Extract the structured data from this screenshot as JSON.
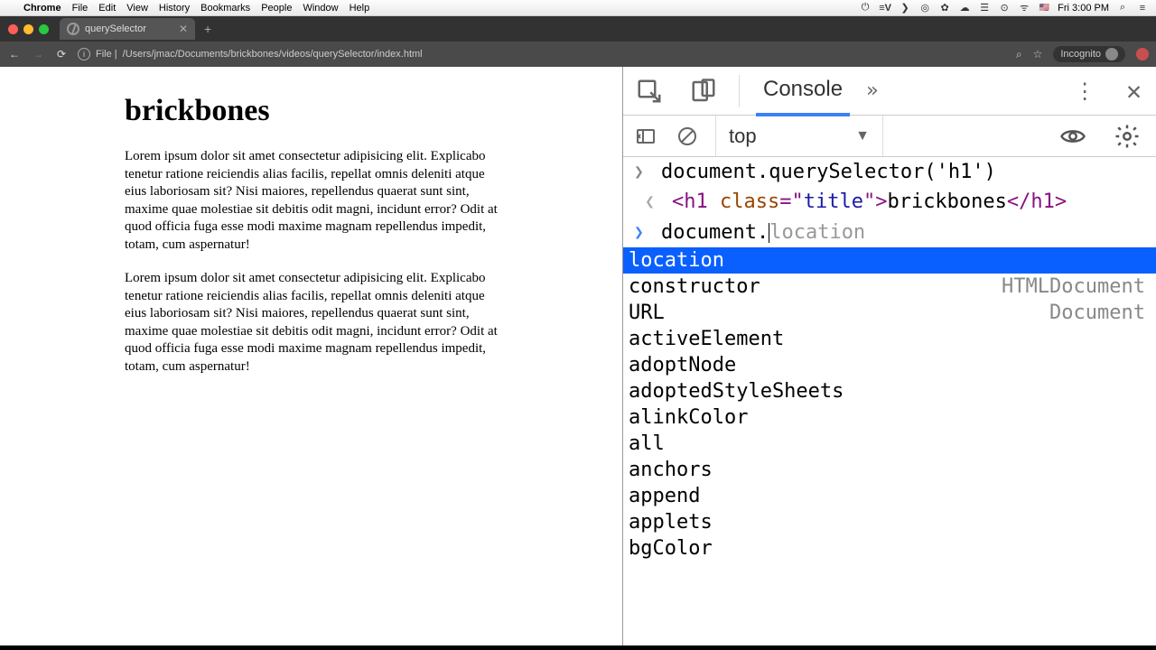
{
  "mac_menubar": {
    "app": "Chrome",
    "items": [
      "File",
      "Edit",
      "View",
      "History",
      "Bookmarks",
      "People",
      "Window",
      "Help"
    ],
    "clock": "Fri 3:00 PM"
  },
  "browser": {
    "tab_title": "querySelector",
    "address_prefix": "File |",
    "address_path": "/Users/jmac/Documents/brickbones/videos/querySelector/index.html",
    "incognito_label": "Incognito"
  },
  "page": {
    "h1": "brickbones",
    "p1": "Lorem ipsum dolor sit amet consectetur adipisicing elit. Explicabo tenetur ratione reiciendis alias facilis, repellat omnis deleniti atque eius laboriosam sit? Nisi maiores, repellendus quaerat sunt sint, maxime quae molestiae sit debitis odit magni, incidunt error? Odit at quod officia fuga esse modi maxime magnam repellendus impedit, totam, cum aspernatur!",
    "p2": "Lorem ipsum dolor sit amet consectetur adipisicing elit. Explicabo tenetur ratione reiciendis alias facilis, repellat omnis deleniti atque eius laboriosam sit? Nisi maiores, repellendus quaerat sunt sint, maxime quae molestiae sit debitis odit magni, incidunt error? Odit at quod officia fuga esse modi maxime magnam repellendus impedit, totam, cum aspernatur!"
  },
  "devtools": {
    "active_tab": "Console",
    "context": "top",
    "history": {
      "input1": "document.querySelector('h1')",
      "output1_tag_open": "<h1 ",
      "output1_attr_name": "class",
      "output1_attr_eq": "=\"",
      "output1_attr_val": "title",
      "output1_attr_close": "\">",
      "output1_text": "brickbones",
      "output1_tag_close": "</h1>"
    },
    "current_input_typed": "document.",
    "current_input_ghost": "location",
    "autocomplete": [
      {
        "name": "location",
        "hint": "",
        "selected": true
      },
      {
        "name": "constructor",
        "hint": "HTMLDocument"
      },
      {
        "name": "URL",
        "hint": "Document"
      },
      {
        "name": "activeElement",
        "hint": ""
      },
      {
        "name": "adoptNode",
        "hint": ""
      },
      {
        "name": "adoptedStyleSheets",
        "hint": ""
      },
      {
        "name": "alinkColor",
        "hint": ""
      },
      {
        "name": "all",
        "hint": ""
      },
      {
        "name": "anchors",
        "hint": ""
      },
      {
        "name": "append",
        "hint": ""
      },
      {
        "name": "applets",
        "hint": ""
      },
      {
        "name": "bgColor",
        "hint": ""
      }
    ]
  }
}
